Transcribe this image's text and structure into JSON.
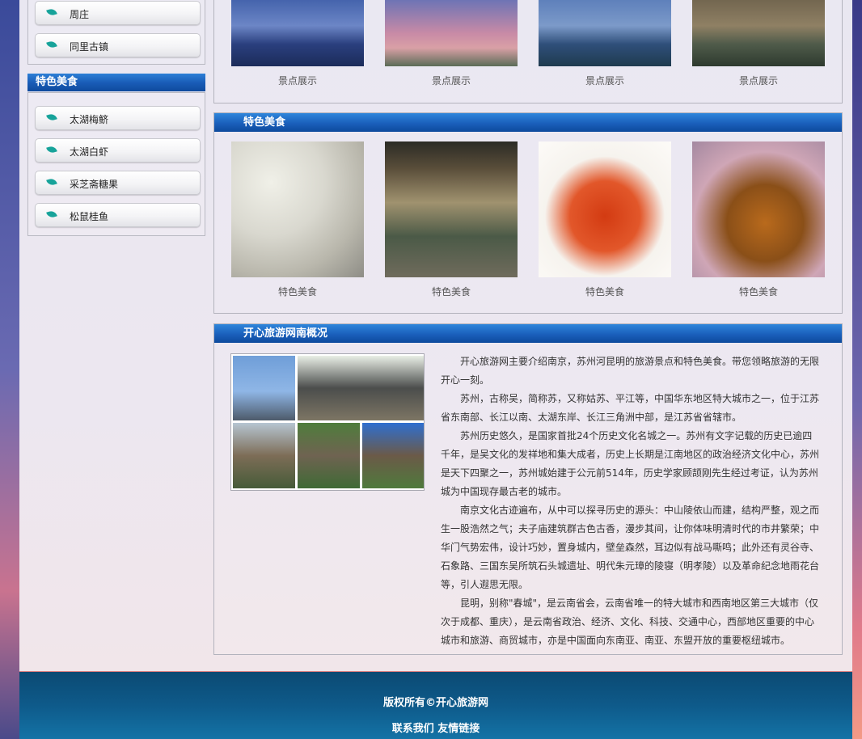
{
  "sidebar": {
    "towns": {
      "items": [
        {
          "label": "周庄"
        },
        {
          "label": "同里古镇"
        }
      ]
    },
    "food": {
      "title": "特色美食",
      "items": [
        {
          "label": "太湖梅鲚"
        },
        {
          "label": "太湖白虾"
        },
        {
          "label": "采芝斋糖果"
        },
        {
          "label": "松鼠桂鱼"
        }
      ]
    }
  },
  "scenic": {
    "items": [
      {
        "caption": "景点展示"
      },
      {
        "caption": "景点展示"
      },
      {
        "caption": "景点展示"
      },
      {
        "caption": "景点展示"
      }
    ]
  },
  "food_panel": {
    "title": "特色美食",
    "items": [
      {
        "caption": "特色美食"
      },
      {
        "caption": "特色美食"
      },
      {
        "caption": "特色美食"
      },
      {
        "caption": "特色美食"
      }
    ]
  },
  "about": {
    "title": "开心旅游网南概况",
    "paragraphs": [
      "开心旅游网主要介绍南京，苏州河昆明的旅游景点和特色美食。带您领略旅游的无限开心一刻。",
      "苏州，古称吴，简称苏，又称姑苏、平江等，中国华东地区特大城市之一，位于江苏省东南部、长江以南、太湖东岸、长江三角洲中部，是江苏省省辖市。",
      "苏州历史悠久，是国家首批24个历史文化名城之一。苏州有文字记载的历史已逾四千年，是吴文化的发祥地和集大成者，历史上长期是江南地区的政治经济文化中心，苏州是天下四聚之一，苏州城始建于公元前514年，历史学家顾颉刚先生经过考证，认为苏州城为中国现存最古老的城市。",
      "南京文化古迹遍布，从中可以探寻历史的源头：中山陵依山而建，结构严整，观之而生一股浩然之气；夫子庙建筑群古色古香，漫步其间，让你体味明清时代的市井繁荣；中华门气势宏伟，设计巧妙，置身城内，壁垒森然，耳边似有战马嘶鸣；此外还有灵谷寺、石象路、三国东吴所筑石头城遗址、明代朱元璋的陵寝（明孝陵）以及革命纪念地雨花台等，引人遐思无限。",
      "昆明，别称\"春城\"，是云南省会，云南省唯一的特大城市和西南地区第三大城市（仅次于成都、重庆），是云南省政治、经济、文化、科技、交通中心，西部地区重要的中心城市和旅游、商贸城市，亦是中国面向东南亚、南亚、东盟开放的重要枢纽城市。"
    ]
  },
  "footer": {
    "copyright": "版权所有©开心旅游网",
    "contact": "联系我们",
    "links": "友情链接"
  }
}
